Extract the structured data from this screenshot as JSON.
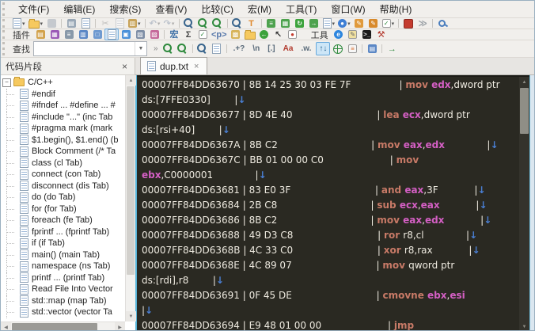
{
  "menu": {
    "items": [
      "文件(F)",
      "编辑(E)",
      "搜索(S)",
      "查看(V)",
      "比较(C)",
      "宏(M)",
      "工具(T)",
      "窗口(W)",
      "帮助(H)"
    ]
  },
  "toolbar_main": {
    "items": [
      {
        "n": "new-file-button",
        "t": "pg",
        "dd": 1
      },
      {
        "n": "open-file-button",
        "t": "fold",
        "dd": 1
      },
      {
        "n": "save-button",
        "t": "sq",
        "c": "#7d96bc",
        "g": "",
        "dis": 1
      },
      {
        "t": "sep"
      },
      {
        "n": "print-button",
        "t": "sq",
        "c": "#9aa8b6",
        "g": "▤"
      },
      {
        "n": "print-preview-button",
        "t": "pg"
      },
      {
        "t": "sep"
      },
      {
        "n": "cut-button",
        "t": "txt",
        "g": "✂",
        "c": "#777777",
        "dis": 1
      },
      {
        "n": "copy-button",
        "t": "pg",
        "dis": 1
      },
      {
        "n": "paste-button",
        "t": "sq",
        "c": "#c7a35a",
        "g": "▥",
        "dd": 1
      },
      {
        "t": "sep"
      },
      {
        "n": "undo-button",
        "t": "txt",
        "g": "↶",
        "c": "#5b87c5",
        "dis": 1,
        "dd": 1
      },
      {
        "n": "redo-button",
        "t": "txt",
        "g": "↷",
        "c": "#5b87c5",
        "dis": 1,
        "dd": 1
      },
      {
        "t": "sep"
      },
      {
        "n": "find-button",
        "t": "mag"
      },
      {
        "n": "find-next-button",
        "t": "mag",
        "grn": 1
      },
      {
        "n": "find-in-files-button",
        "t": "mag",
        "grn": 1
      },
      {
        "t": "sep"
      },
      {
        "n": "search-document-button",
        "t": "mag"
      },
      {
        "n": "filter-button",
        "t": "txt",
        "g": "T",
        "c": "#e08a2e"
      },
      {
        "t": "sep"
      },
      {
        "n": "view-list-button",
        "t": "sq",
        "c": "#4ea24e",
        "g": "≡"
      },
      {
        "n": "view-columns-button",
        "t": "sq",
        "c": "#4ea24e",
        "g": "▦"
      },
      {
        "n": "refresh-button",
        "t": "sq",
        "c": "#3da33d",
        "g": "↻"
      },
      {
        "n": "export-button",
        "t": "sq",
        "c": "#4ea24e",
        "g": "→"
      },
      {
        "n": "run-document-button",
        "t": "pg",
        "dd": 1
      },
      {
        "n": "encoding-button",
        "t": "sq",
        "c": "#3f7fd4",
        "g": "●",
        "round": 1,
        "dd": 1
      },
      {
        "n": "edit-script-button",
        "t": "sq",
        "c": "#e09a3c",
        "g": "✎"
      },
      {
        "n": "edit-config-button",
        "t": "sq",
        "c": "#d88a2c",
        "g": "✎"
      },
      {
        "n": "task-list-button",
        "t": "sq",
        "c": "#ffffff",
        "g": "✓",
        "fg": "#2f8a3e",
        "bd": 1,
        "dd": 1
      },
      {
        "t": "sep"
      },
      {
        "n": "stop-button",
        "t": "stop"
      },
      {
        "n": "step-button",
        "t": "txt",
        "g": "≫",
        "c": "#9aa0a6"
      },
      {
        "t": "sep"
      },
      {
        "n": "key-button",
        "t": "key"
      }
    ]
  },
  "toolbar_plugins": {
    "label": "插件",
    "tools_label": "工具",
    "plugin_items": [
      {
        "n": "clip-history-button",
        "t": "sq",
        "c": "#d2a24c",
        "g": "▤"
      },
      {
        "n": "snippet-library-button",
        "t": "sq",
        "c": "#9b59b6",
        "g": "▦"
      },
      {
        "n": "outline-button",
        "t": "sq",
        "c": "#8899aa",
        "g": "≡"
      },
      {
        "n": "window-split-button",
        "t": "sq",
        "c": "#5b87c5",
        "g": "▥"
      },
      {
        "n": "comment-popup-button",
        "t": "sq",
        "c": "#6f9ad0",
        "g": "□"
      },
      {
        "n": "snippet-panel-button",
        "t": "pg",
        "pressed": 1
      },
      {
        "n": "insert-script-button",
        "t": "sq",
        "c": "#4a90d9",
        "g": "▣"
      },
      {
        "n": "duplicate-button",
        "t": "sq",
        "c": "#7f8fa6",
        "g": "▧"
      },
      {
        "n": "word-complete-button",
        "t": "sq",
        "c": "#c56a9a",
        "g": "▨"
      },
      {
        "t": "sep"
      },
      {
        "n": "macro-button",
        "t": "txt",
        "g": "宏",
        "c": "#3b6ea5"
      },
      {
        "n": "sum-button",
        "t": "txt",
        "g": "Σ",
        "c": "#444444"
      },
      {
        "n": "syntax-check-button",
        "t": "sq",
        "c": "#ffffff",
        "g": "✓",
        "fg": "#2f8a3e",
        "bd": 1
      },
      {
        "n": "tag-pair-button",
        "t": "txt",
        "g": "<p>",
        "c": "#5577aa"
      },
      {
        "n": "contacts-button",
        "t": "sq",
        "c": "#d7b45a",
        "g": "▩"
      },
      {
        "n": "folder-browser-button",
        "t": "fold"
      },
      {
        "n": "navigate-back-button",
        "t": "sq",
        "c": "#3aa23a",
        "g": "←",
        "round": 1
      },
      {
        "n": "pointer-button",
        "t": "txt",
        "g": "↖",
        "c": "#333333"
      },
      {
        "n": "error-doc-button",
        "t": "sq",
        "c": "#ffffff",
        "g": "●",
        "fg": "#c43b2e",
        "bd": 1
      }
    ],
    "tool_items": [
      {
        "n": "browser-preview-button",
        "t": "sq",
        "c": "#2e86de",
        "g": "e",
        "round": 1
      },
      {
        "n": "notepad-button",
        "t": "sq",
        "c": "#f0e0a0",
        "g": "✎",
        "fg": "#666666",
        "bd": 1
      },
      {
        "n": "console-button",
        "t": "sq",
        "c": "#1a1a1a",
        "g": ">_",
        "fg": "#dddddd"
      },
      {
        "n": "build-button",
        "t": "txt",
        "g": "⚒",
        "c": "#b3392e"
      }
    ]
  },
  "find_bar": {
    "label": "查找",
    "value": "",
    "items": [
      {
        "n": "toolbar-overflow",
        "t": "ovf",
        "g": "»"
      },
      {
        "n": "find-next-button",
        "t": "mag",
        "grn": 1
      },
      {
        "n": "find-prev-button",
        "t": "mag",
        "grn": 1
      },
      {
        "t": "sep"
      },
      {
        "n": "find-in-doc-button",
        "t": "mag"
      },
      {
        "n": "copy-results-button",
        "t": "pg"
      },
      {
        "t": "sep"
      },
      {
        "n": "regex-toggle",
        "t": "tg",
        "g": ".+?"
      },
      {
        "n": "newline-toggle",
        "t": "tg",
        "g": "\\n"
      },
      {
        "n": "charclass-toggle",
        "t": "tg",
        "g": "[.]"
      },
      {
        "n": "match-case-toggle",
        "t": "tg",
        "g": "Aa",
        "c": "#b23b2e"
      },
      {
        "n": "whole-word-toggle",
        "t": "tg",
        "g": ".w."
      },
      {
        "n": "direction-toggle",
        "t": "tg",
        "g": "↑↓",
        "pressed": 1
      },
      {
        "n": "global-search-button",
        "t": "globe"
      },
      {
        "n": "search-list-button",
        "t": "sq",
        "c": "#f7f7f7",
        "g": "≡",
        "fg": "#d86b2a",
        "bd": 1
      },
      {
        "t": "sep"
      },
      {
        "n": "results-panel-button",
        "t": "sq",
        "c": "#5b87c5",
        "g": "▤"
      },
      {
        "t": "sep"
      },
      {
        "n": "goto-next-button",
        "t": "txt",
        "g": "→",
        "c": "#2f8a3e"
      }
    ]
  },
  "snippets_panel": {
    "title": "代码片段",
    "close": "×",
    "root": "C/C++",
    "items": [
      "#endif",
      "#ifndef ... #define ... #",
      "#include \"...\"  (inc Tab",
      "#pragma mark  (mark",
      "$1.begin(), $1.end()  (b",
      "Block Comment  (/* Ta",
      "class  (cl Tab)",
      "connect  (con Tab)",
      "disconnect  (dis Tab)",
      "do  (do Tab)",
      "for  (for Tab)",
      "foreach  (fe Tab)",
      "fprintf ...  (fprintf Tab)",
      "if  (if Tab)",
      "main()  (main Tab)",
      "namespace  (ns Tab)",
      "printf ...  (printf Tab)",
      "Read File Into Vector",
      "std::map  (map Tab)",
      "std::vector  (vector Ta"
    ]
  },
  "tabs": {
    "active": "dup.txt",
    "close": "×"
  },
  "editor": {
    "lines": [
      [
        [
          "t",
          "00007FF84DD63670 | 8B 14 25 30 03 FE 7F                | "
        ],
        [
          "o",
          "mov "
        ],
        [
          "r",
          "edx"
        ],
        [
          "t",
          ",dword ptr"
        ]
      ],
      [
        [
          "t",
          "ds:[7FFE0330]        |"
        ],
        [
          "a",
          "↓"
        ]
      ],
      [
        [
          "t",
          "00007FF84DD63677 | 8D 4E 40                            | "
        ],
        [
          "o",
          "lea "
        ],
        [
          "r",
          "ecx"
        ],
        [
          "t",
          ",dword ptr"
        ]
      ],
      [
        [
          "t",
          "ds:[rsi+40]        |"
        ],
        [
          "a",
          "↓"
        ]
      ],
      [
        [
          "t",
          "00007FF84DD6367A | 8B C2                               | "
        ],
        [
          "o",
          "mov "
        ],
        [
          "r",
          "eax"
        ],
        [
          "t",
          ","
        ],
        [
          "r",
          "edx"
        ],
        [
          "t",
          "              |"
        ],
        [
          "a",
          "↓"
        ]
      ],
      [
        [
          "t",
          "00007FF84DD6367C | BB 01 00 00 C0                      | "
        ],
        [
          "o",
          "mov"
        ]
      ],
      [
        [
          "r",
          "ebx"
        ],
        [
          "t",
          ",C0000001              |"
        ],
        [
          "a",
          "↓"
        ]
      ],
      [
        [
          "t",
          "00007FF84DD63681 | 83 E0 3F                            | "
        ],
        [
          "o",
          "and "
        ],
        [
          "r",
          "eax"
        ],
        [
          "t",
          ",3F            |"
        ],
        [
          "a",
          "↓"
        ]
      ],
      [
        [
          "t",
          "00007FF84DD63684 | 2B C8                               | "
        ],
        [
          "o",
          "sub "
        ],
        [
          "r",
          "ecx"
        ],
        [
          "t",
          ","
        ],
        [
          "r",
          "eax"
        ],
        [
          "t",
          "            |"
        ],
        [
          "a",
          "↓"
        ]
      ],
      [
        [
          "t",
          "00007FF84DD63686 | 8B C2                               | "
        ],
        [
          "o",
          "mov "
        ],
        [
          "r",
          "eax"
        ],
        [
          "t",
          ","
        ],
        [
          "r",
          "edx"
        ],
        [
          "t",
          "            |"
        ],
        [
          "a",
          "↓"
        ]
      ],
      [
        [
          "t",
          "00007FF84DD63688 | 49 D3 C8                            | "
        ],
        [
          "o",
          "ror "
        ],
        [
          "t",
          "r8,cl              |"
        ],
        [
          "a",
          "↓"
        ]
      ],
      [
        [
          "t",
          "00007FF84DD6368B | 4C 33 C0                            | "
        ],
        [
          "o",
          "xor "
        ],
        [
          "t",
          "r8,rax            |"
        ],
        [
          "a",
          "↓"
        ]
      ],
      [
        [
          "t",
          "00007FF84DD6368E | 4C 89 07                            | "
        ],
        [
          "o",
          "mov "
        ],
        [
          "t",
          "qword ptr"
        ]
      ],
      [
        [
          "t",
          "ds:[rdi],r8        |"
        ],
        [
          "a",
          "↓"
        ]
      ],
      [
        [
          "t",
          "00007FF84DD63691 | 0F 45 DE                            | "
        ],
        [
          "o",
          "cmovne "
        ],
        [
          "r",
          "ebx"
        ],
        [
          "t",
          ","
        ],
        [
          "r",
          "esi"
        ]
      ],
      [
        [
          "t",
          "|"
        ],
        [
          "a",
          "↓"
        ]
      ],
      [
        [
          "t",
          "00007FF84DD63694 | E9 48 01 00 00                      | "
        ],
        [
          "o",
          "jmp"
        ]
      ]
    ]
  }
}
